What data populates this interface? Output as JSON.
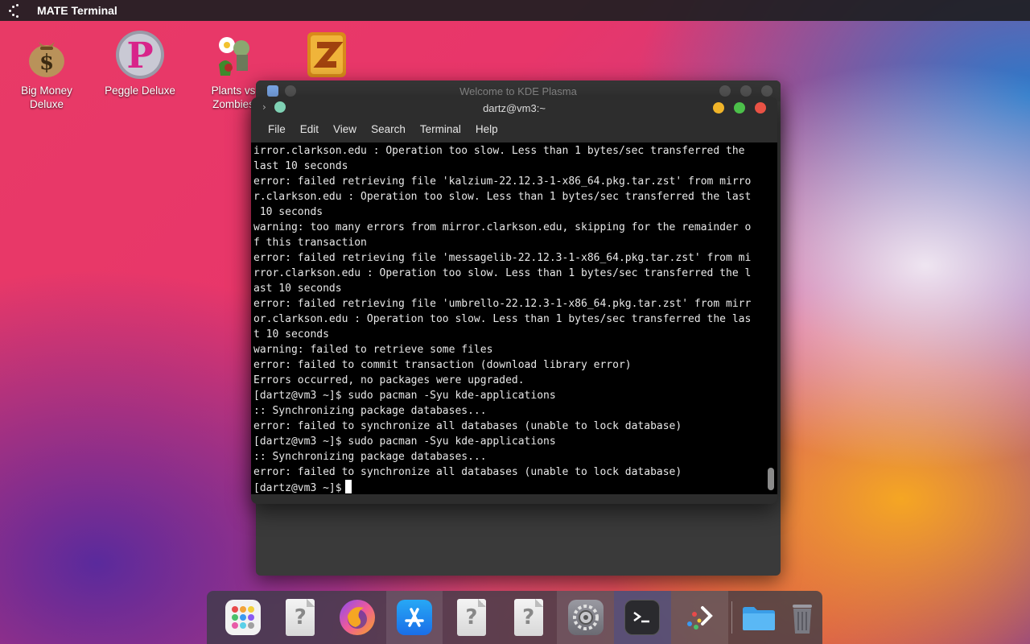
{
  "top_panel": {
    "app_title": "MATE Terminal"
  },
  "desktop_icons": [
    {
      "label": "Big Money\nDeluxe",
      "icon": "money-bag-icon"
    },
    {
      "label": "Peggle Deluxe",
      "icon": "peggle-icon"
    },
    {
      "label": "Plants vs\nZombies",
      "icon": "plants-vs-zombies-icon"
    },
    {
      "label": "",
      "icon": "zuma-icon"
    }
  ],
  "kde_window": {
    "title": "Welcome to KDE Plasma"
  },
  "terminal": {
    "title": "dartz@vm3:~",
    "menu": [
      "File",
      "Edit",
      "View",
      "Search",
      "Terminal",
      "Help"
    ],
    "lines": [
      "irror.clarkson.edu : Operation too slow. Less than 1 bytes/sec transferred the",
      "last 10 seconds",
      "error: failed retrieving file 'kalzium-22.12.3-1-x86_64.pkg.tar.zst' from mirro",
      "r.clarkson.edu : Operation too slow. Less than 1 bytes/sec transferred the last",
      " 10 seconds",
      "warning: too many errors from mirror.clarkson.edu, skipping for the remainder o",
      "f this transaction",
      "error: failed retrieving file 'messagelib-22.12.3-1-x86_64.pkg.tar.zst' from mi",
      "rror.clarkson.edu : Operation too slow. Less than 1 bytes/sec transferred the l",
      "ast 10 seconds",
      "error: failed retrieving file 'umbrello-22.12.3-1-x86_64.pkg.tar.zst' from mirr",
      "or.clarkson.edu : Operation too slow. Less than 1 bytes/sec transferred the las",
      "t 10 seconds",
      "warning: failed to retrieve some files",
      "error: failed to commit transaction (download library error)",
      "Errors occurred, no packages were upgraded.",
      "[dartz@vm3 ~]$ sudo pacman -Syu kde-applications",
      ":: Synchronizing package databases...",
      "error: failed to synchronize all databases (unable to lock database)",
      "[dartz@vm3 ~]$ sudo pacman -Syu kde-applications",
      ":: Synchronizing package databases...",
      "error: failed to synchronize all databases (unable to lock database)"
    ],
    "prompt": "[dartz@vm3 ~]$"
  },
  "dock": {
    "items": [
      {
        "icon": "app-grid-icon"
      },
      {
        "icon": "unknown-document-icon",
        "glyph": "?"
      },
      {
        "icon": "firefox-icon"
      },
      {
        "icon": "app-store-icon"
      },
      {
        "icon": "unknown-document-icon",
        "glyph": "?"
      },
      {
        "icon": "unknown-document-icon",
        "glyph": "?"
      },
      {
        "icon": "system-settings-icon"
      },
      {
        "icon": "terminal-icon"
      },
      {
        "icon": "kde-welcome-icon"
      },
      {
        "icon": "folder-icon"
      },
      {
        "icon": "trash-icon"
      }
    ]
  },
  "colors": {
    "close": "#e95245",
    "maximize": "#4cc04a",
    "minimize": "#f0b429",
    "terminal_bg": "#000000",
    "terminal_fg": "#e8e8e8"
  }
}
